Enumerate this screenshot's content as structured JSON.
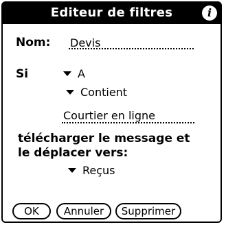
{
  "window": {
    "title": "Editeur de filtres",
    "info_icon": "info-icon"
  },
  "form": {
    "name_label": "Nom:",
    "name_value": "Devis",
    "if_label": "Si",
    "field_picker": "A",
    "condition_picker": "Contient",
    "condition_value": "Courtier en ligne",
    "action_prompt_line1": "télécharger le message et",
    "action_prompt_line2": "le déplacer vers:",
    "folder_picker": "Reçus"
  },
  "buttons": {
    "ok": "OK",
    "cancel": "Annuler",
    "delete": "Supprimer"
  }
}
